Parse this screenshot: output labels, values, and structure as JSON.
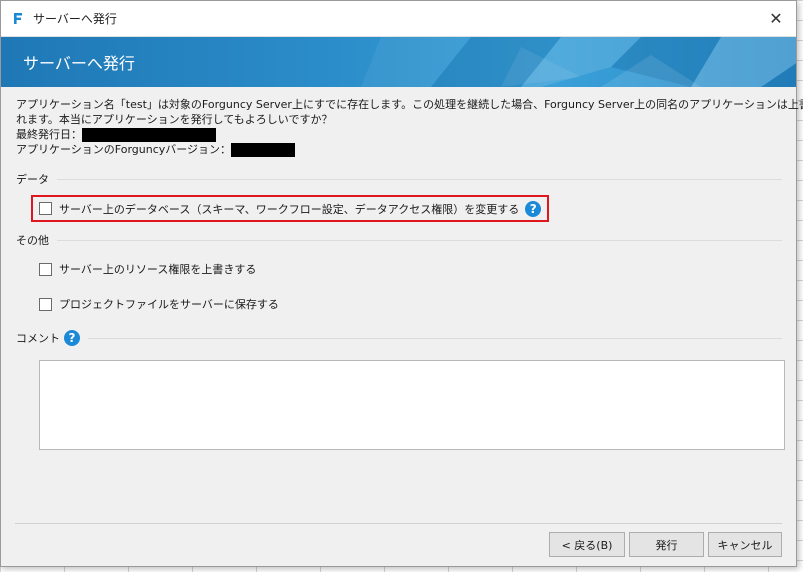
{
  "window": {
    "icon": "forguncy-logo-icon",
    "title": "サーバーへ発行",
    "close_label": "✕"
  },
  "banner": {
    "title": "サーバーへ発行"
  },
  "info": {
    "message_line1": "アプリケーション名「test」は対象のForguncy Server上にすでに存在します。この処理を継続した場合、Forguncy Server上の同名のアプリケーションは上書きさ",
    "message_line2": "れます。本当にアプリケーションを発行してもよろしいですか？",
    "last_published_label": "最終発行日：",
    "version_label": "アプリケーションのForguncyバージョン："
  },
  "data_section": {
    "heading": "データ",
    "change_db_option": {
      "label": "サーバー上のデータベース（スキーマ、ワークフロー設定、データアクセス権限）を変更する",
      "checked": false
    }
  },
  "other_section": {
    "heading": "その他",
    "options": [
      {
        "label": "サーバー上のリソース権限を上書きする",
        "checked": false
      },
      {
        "label": "プロジェクトファイルをサーバーに保存する",
        "checked": false
      }
    ]
  },
  "comment_section": {
    "heading": "コメント",
    "value": ""
  },
  "help_glyph": "?",
  "buttons": {
    "back": "< 戻る(B)",
    "publish": "発行",
    "cancel": "キャンセル"
  },
  "colors": {
    "highlight": "#e0161e",
    "help": "#1a8ad8",
    "banner": "#2a8cc8"
  }
}
